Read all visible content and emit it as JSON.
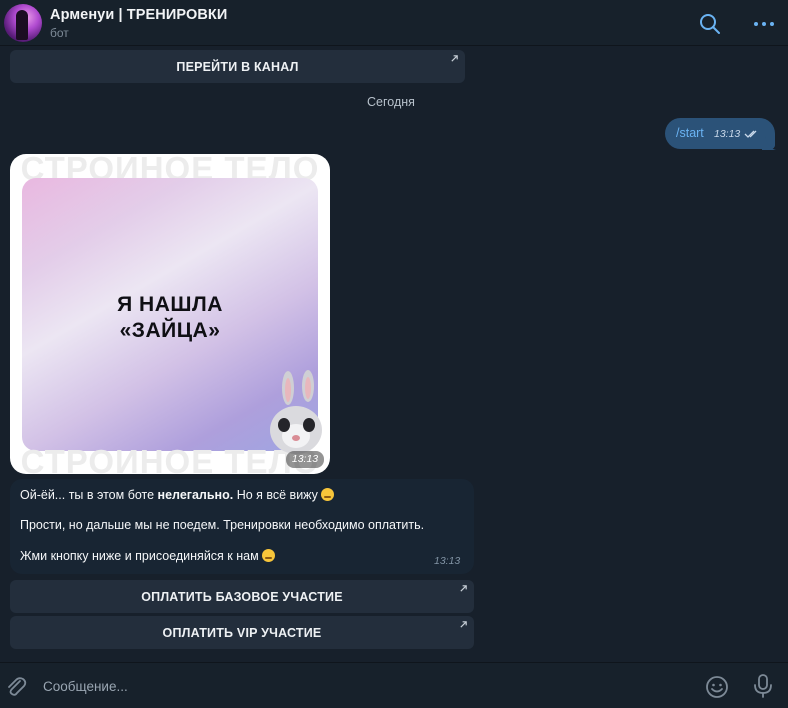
{
  "header": {
    "title": "Арменуи | ТРЕНИРОВКИ",
    "subtitle": "бот",
    "icons": [
      "search-icon",
      "more-icon"
    ]
  },
  "channel_button": {
    "label": "ПЕРЕЙТИ В КАНАЛ"
  },
  "date_separator": "Сегодня",
  "outgoing": {
    "text": "/start",
    "time": "13:13"
  },
  "image_message": {
    "watermark_top": "СТРОИНОЕ ТЕЛО",
    "watermark_bottom": "СТРОИНОЕ ТЕЛО",
    "card_line1": "Я НАШЛА",
    "card_line2": "«ЗАЙЦА»",
    "time": "13:13"
  },
  "text_message": {
    "line1_start": "Ой-ёй... ты в этом боте ",
    "line1_bold": "нелегально.",
    "line1_end": " Но я всё вижу",
    "line2": "Прости, но дальше мы не поедем. Тренировки необходимо оплатить.",
    "line3": "Жми кнопку ниже и присоединяйся к нам",
    "time": "13:13"
  },
  "pay_buttons": {
    "basic": "ОПЛАТИТЬ БАЗОВОЕ УЧАСТИЕ",
    "vip": "ОПЛАТИТЬ VIP УЧАСТИЕ"
  },
  "composer": {
    "placeholder": "Сообщение..."
  },
  "colors": {
    "background": "#17202b",
    "outgoing_bubble": "#2b5278",
    "incoming_bubble": "#182533",
    "button": "#232e3c",
    "accent": "#6ab3f3"
  }
}
